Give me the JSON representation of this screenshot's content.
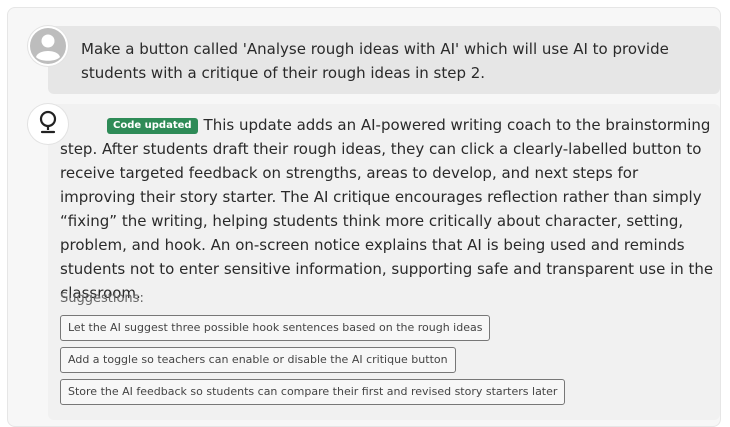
{
  "user_message": {
    "avatar_icon": "user-silhouette-icon",
    "text": "Make a button called 'Analyse rough ideas with AI' which will use AI to provide students with a critique of their rough ideas in step 2."
  },
  "ai_message": {
    "avatar_icon": "assistant-logo-icon",
    "badge": "Code updated",
    "badge_color": "#2e8b57",
    "text": "This update adds an AI-powered writing coach to the brainstorming step. After students draft their rough ideas, they can click a clearly-labelled button to receive targeted feedback on strengths, areas to develop, and next steps for improving their story starter. The AI critique encourages reflection rather than simply “fixing” the writing, helping students think more critically about character, setting, problem, and hook. An on-screen notice explains that AI is being used and reminds students not to enter sensitive information, supporting safe and transparent use in the classroom."
  },
  "suggestions": {
    "label": "Suggestions:",
    "items": [
      "Let the AI suggest three possible hook sentences based on the rough ideas",
      "Add a toggle so teachers can enable or disable the AI critique button",
      "Store the AI feedback so students can compare their first and revised story starters later"
    ]
  }
}
